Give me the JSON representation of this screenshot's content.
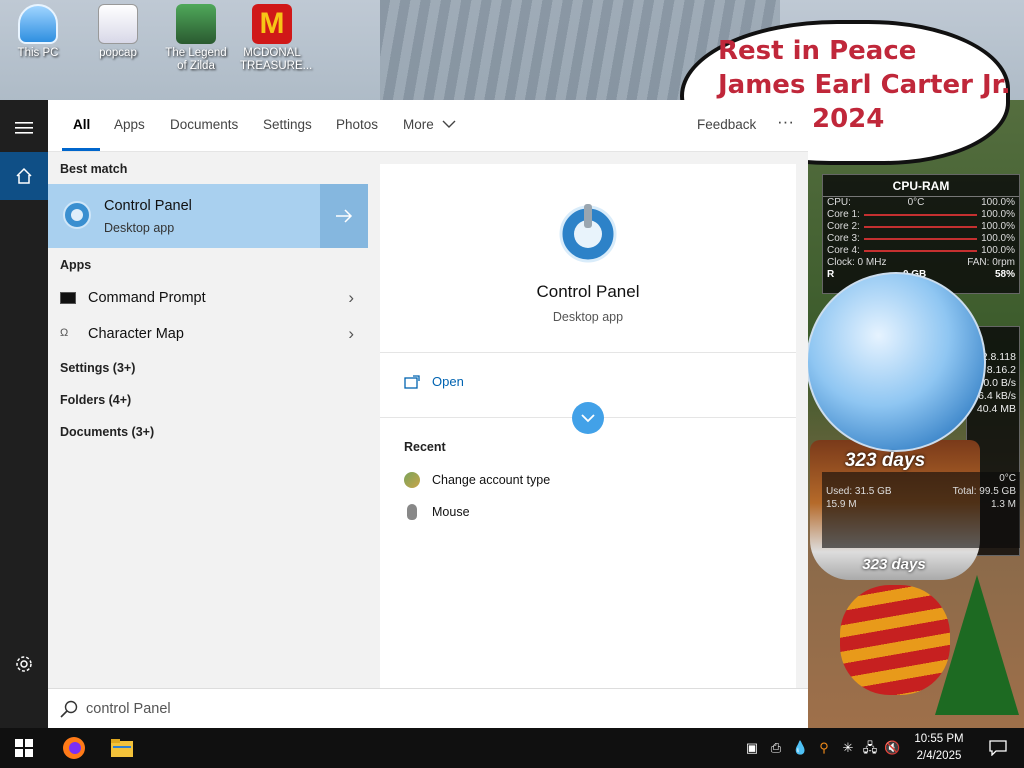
{
  "desktop": {
    "icons": [
      {
        "label": "This PC",
        "name": "this-pc-icon"
      },
      {
        "label": "popcap",
        "name": "popcap-icon"
      },
      {
        "label": "The Legend of Zilda",
        "name": "legend-zilda-icon"
      },
      {
        "label": "MCDONAL TREASURE...",
        "name": "mcdonal-treasure-icon"
      }
    ],
    "bubble_lines": [
      "Rest in Peace",
      "James Earl Carter Jr.",
      "2024"
    ]
  },
  "widgets": {
    "cpu_ram": {
      "title": "CPU-RAM",
      "cpu_label": "CPU:",
      "cpu_temp": "0°C",
      "cpu_pct": "100.0%",
      "cores": [
        {
          "label": "Core 1:",
          "value": "100.0%"
        },
        {
          "label": "Core 2:",
          "value": "100.0%"
        },
        {
          "label": "Core 3:",
          "value": "100.0%"
        },
        {
          "label": "Core 4:",
          "value": "100.0%"
        }
      ],
      "clock": "Clock: 0 MHz",
      "fan": "FAN: 0rpm",
      "ram_label": "R",
      "ram_value": "0 GB",
      "ram_pct": "58%"
    },
    "network": [
      "2.8.118",
      "8.16.2",
      "0.0 B/s",
      "6.4 kB/s",
      "40.4 MB"
    ],
    "globe_days": "323 days",
    "base_days": "323 days",
    "disk": {
      "temp": "0°C",
      "used": "Used: 31.5 GB",
      "total": "Total: 99.5 GB",
      "read": "15.9 M",
      "write": "1.3 M"
    }
  },
  "start": {
    "tabs": [
      "All",
      "Apps",
      "Documents",
      "Settings",
      "Photos",
      "More"
    ],
    "feedback": "Feedback",
    "more_options": "···",
    "best_match_header": "Best match",
    "best_match": {
      "title": "Control Panel",
      "subtitle": "Desktop app"
    },
    "apps_header": "Apps",
    "apps": [
      {
        "label": "Command Prompt"
      },
      {
        "label": "Character Map"
      }
    ],
    "groups": [
      "Settings (3+)",
      "Folders (4+)",
      "Documents (3+)"
    ],
    "preview": {
      "title": "Control Panel",
      "subtitle": "Desktop app",
      "open_label": "Open",
      "recent_header": "Recent",
      "recent": [
        "Change account type",
        "Mouse"
      ]
    },
    "search_value": "control Panel"
  },
  "taskbar": {
    "time": "10:55 PM",
    "date": "2/4/2025"
  },
  "colors": {
    "accent": "#0063b1",
    "best_match_bg": "#a9d0ef",
    "rail_bg": "#1f1f1f",
    "taskbar_bg": "#101010",
    "bubble_text": "#c0273a"
  }
}
